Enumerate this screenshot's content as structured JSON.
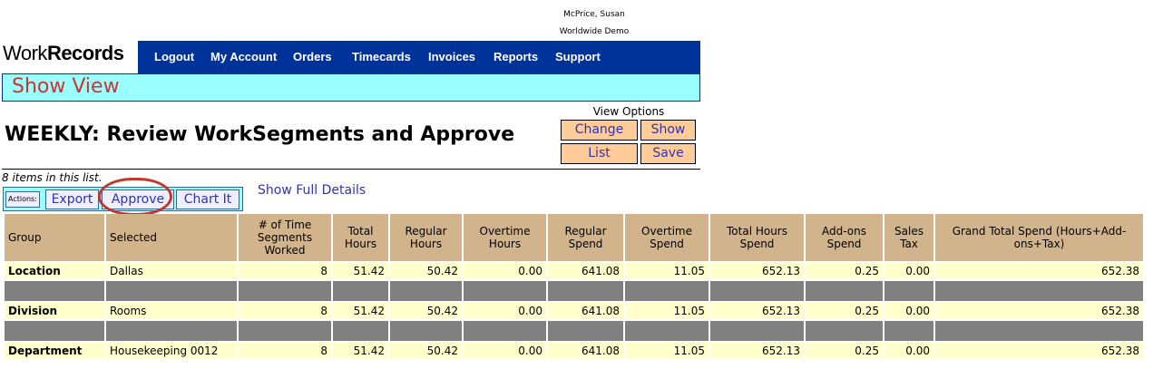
{
  "user": {
    "name": "McPrice, Susan",
    "company": "Worldwide Demo"
  },
  "logo": {
    "part1": "Work",
    "part2": "Records"
  },
  "nav": [
    "Logout",
    "My Account",
    "Orders",
    "Timecards",
    "Invoices",
    "Reports",
    "Support"
  ],
  "view_bar": {
    "title": "Show View"
  },
  "page": {
    "title": "WEEKLY: Review WorkSegments and Approve",
    "item_count": "8 items in this list."
  },
  "view_options": {
    "label": "View Options",
    "buttons": [
      "Change",
      "Show",
      "List",
      "Save"
    ]
  },
  "actions": {
    "label": "Actions:",
    "buttons": [
      "Export",
      "Approve",
      "Chart It"
    ],
    "full_details": "Show Full Details"
  },
  "table": {
    "headers": [
      "Group",
      "Selected",
      "# of Time Segments Worked",
      "Total Hours",
      "Regular Hours",
      "Overtime Hours",
      "Regular Spend",
      "Overtime Spend",
      "Total Hours Spend",
      "Add-ons Spend",
      "Sales Tax",
      "Grand Total Spend (Hours+Add-ons+Tax)"
    ],
    "rows": [
      {
        "group": "Location",
        "selected": "Dallas",
        "values": [
          "8",
          "51.42",
          "50.42",
          "0.00",
          "641.08",
          "11.05",
          "652.13",
          "0.25",
          "0.00",
          "652.38"
        ]
      },
      {
        "group": "Division",
        "selected": "Rooms",
        "values": [
          "8",
          "51.42",
          "50.42",
          "0.00",
          "641.08",
          "11.05",
          "652.13",
          "0.25",
          "0.00",
          "652.38"
        ]
      },
      {
        "group": "Department",
        "selected": "Housekeeping 0012",
        "values": [
          "8",
          "51.42",
          "50.42",
          "0.00",
          "641.08",
          "11.05",
          "652.13",
          "0.25",
          "0.00",
          "652.38"
        ]
      }
    ]
  }
}
